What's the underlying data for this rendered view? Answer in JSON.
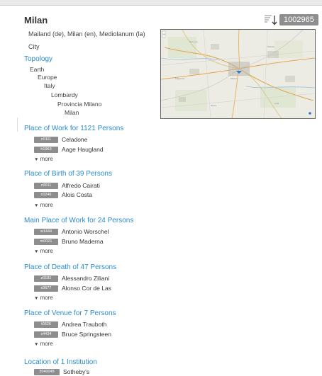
{
  "header": {
    "title": "Milan",
    "id_badge": "1002965",
    "sort_icon": "sort-descending-icon"
  },
  "entity": {
    "names": "Mailand (de), Milan (en), Mediolanum (la)",
    "type": "City"
  },
  "topology": {
    "title": "Topology",
    "levels": [
      "Earth",
      "Europe",
      "Italy",
      "Lombardy",
      "Provincia Milano",
      "Milan"
    ]
  },
  "map": {
    "accent_marker_color": "#2b7bd4",
    "base_color": "#eceae3"
  },
  "sections": [
    {
      "title": "Place of Work for 1121 Persons",
      "items": [
        {
          "code": "c0111",
          "name": "Celadone"
        },
        {
          "code": "h1963",
          "name": "Aage Haugland"
        }
      ],
      "more": "more"
    },
    {
      "title": "Place of Birth of 39 Persons",
      "items": [
        {
          "code": "c0011",
          "name": "Alfredo Cairati"
        },
        {
          "code": "c0246",
          "name": "Alois Costa"
        }
      ],
      "more": "more"
    },
    {
      "title": "Main Place of Work for 24 Persons",
      "items": [
        {
          "code": "w1444",
          "name": "Antonio Worschel"
        },
        {
          "code": "m0021",
          "name": "Bruno Maderna"
        }
      ],
      "more": "more"
    },
    {
      "title": "Place of Death of 47 Persons",
      "items": [
        {
          "code": "z0181",
          "name": "Alessandro Ziliani"
        },
        {
          "code": "c0677",
          "name": "Alonso Cor de Las"
        }
      ],
      "more": "more"
    },
    {
      "title": "Place of Venue for 7 Persons",
      "items": [
        {
          "code": "t0526",
          "name": "Andrea Trauboth"
        },
        {
          "code": "s4434",
          "name": "Bruce Springsteen"
        }
      ],
      "more": "more"
    },
    {
      "title": "Location of 1 Institution",
      "items": [
        {
          "code": "3040048",
          "name": "Sotheby's"
        }
      ]
    }
  ],
  "colors": {
    "link": "#2b8ccc",
    "badge": "#8d8d8d",
    "id_badge": "#8e8e8e"
  }
}
